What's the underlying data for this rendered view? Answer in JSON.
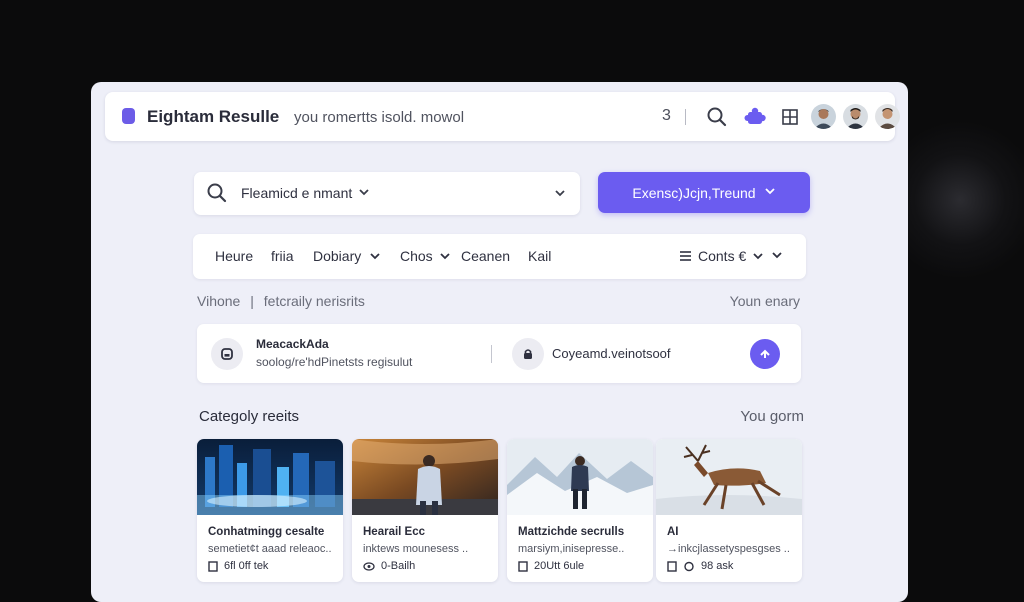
{
  "app": {
    "title": "Eightam Resulle",
    "subtitle": "you romertts isold. mowol",
    "count": "3",
    "accent": "#6b5cf0"
  },
  "topbar_icons": [
    "search-icon",
    "puzzle-icon",
    "grid-icon"
  ],
  "search": {
    "value": "Fleamicd e nmant",
    "primary_button": "Exensc)Jcjn,Treund"
  },
  "filters": {
    "items": [
      {
        "label": "Heure",
        "dropdown": false
      },
      {
        "label": "friia",
        "dropdown": false
      },
      {
        "label": "Dobiary",
        "dropdown": true
      },
      {
        "label": "Chos",
        "dropdown": true
      },
      {
        "label": "Ceanen",
        "dropdown": false
      },
      {
        "label": "Kail",
        "dropdown": false
      }
    ],
    "sort_label": "Conts €"
  },
  "breadcrumb": {
    "left_a": "Vihone",
    "left_b": "fetcraily nerisrits",
    "right": "Youn enary"
  },
  "notification": {
    "title": "MeacackAda",
    "subtitle": "soolog/re'hdPinetsts regisulut",
    "text": "Coyeamd.veinotsoof"
  },
  "category": {
    "title": "Categoly reeits",
    "right": "You gorm",
    "cards": [
      {
        "title": "Conhatmingg cesalte",
        "subtitle": "semetiet¢t aaad releaoc..",
        "meta": "6fl  0ff tek"
      },
      {
        "title": "Hearail Ecc",
        "subtitle": "inktews mounesess ..",
        "meta": "0-Bailh"
      },
      {
        "title": "Mattzichde secrulls",
        "subtitle": "marsiym,inisepresse..",
        "meta": "20Utt 6ule"
      },
      {
        "title": "AI",
        "subtitle": "→inkcjlassetyspesgses ..",
        "meta": "98 ask"
      }
    ]
  }
}
